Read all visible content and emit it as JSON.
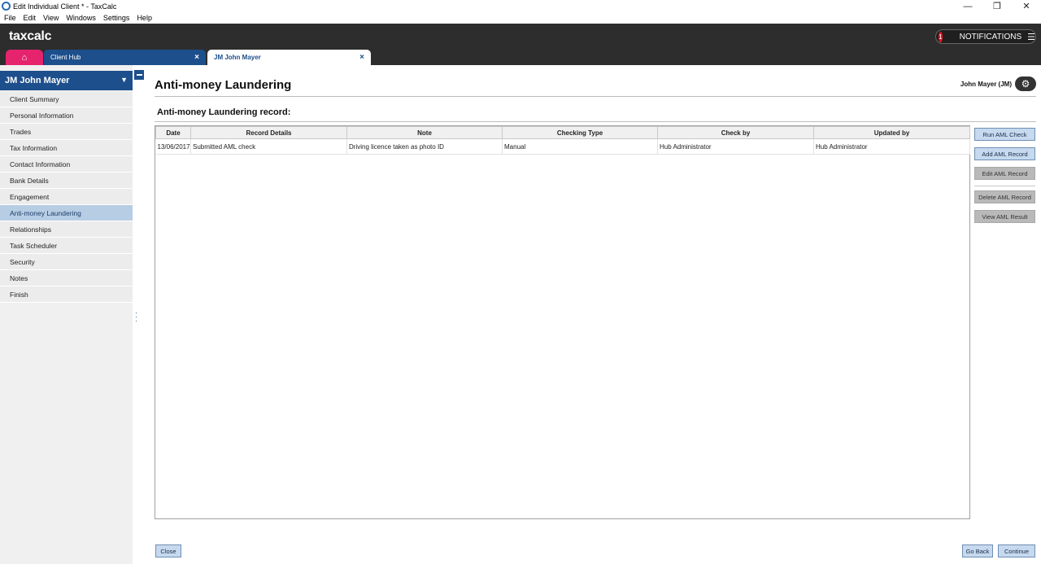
{
  "window": {
    "title": "Edit Individual Client * - TaxCalc",
    "controls": {
      "minimize": "—",
      "restore": "❐",
      "close": "✕"
    }
  },
  "menu": [
    "File",
    "Edit",
    "View",
    "Windows",
    "Settings",
    "Help"
  ],
  "header": {
    "logo": "taxcalc",
    "notifications": {
      "count": "1",
      "label": "NOTIFICATIONS"
    }
  },
  "tabs": [
    {
      "label": "Client Hub"
    },
    {
      "label": "JM John Mayer"
    }
  ],
  "sidebar": {
    "client_name": "JM John  Mayer",
    "items": [
      {
        "label": "Client Summary",
        "active": false
      },
      {
        "label": "Personal Information",
        "active": false
      },
      {
        "label": "Trades",
        "active": false
      },
      {
        "label": "Tax Information",
        "active": false
      },
      {
        "label": "Contact Information",
        "active": false
      },
      {
        "label": "Bank Details",
        "active": false
      },
      {
        "label": "Engagement",
        "active": false
      },
      {
        "label": "Anti-money Laundering",
        "active": true
      },
      {
        "label": "Relationships",
        "active": false
      },
      {
        "label": "Task Scheduler",
        "active": false
      },
      {
        "label": "Security",
        "active": false
      },
      {
        "label": "Notes",
        "active": false
      },
      {
        "label": "Finish",
        "active": false
      }
    ]
  },
  "main": {
    "title": "Anti-money Laundering",
    "user": "John Mayer (JM)",
    "section_title": "Anti-money Laundering record:",
    "table": {
      "columns": [
        "Date",
        "Record Details",
        "Note",
        "Checking Type",
        "Check by",
        "Updated by"
      ],
      "rows": [
        [
          "13/06/2017",
          "Submitted AML check",
          "Driving licence taken as photo ID",
          "Manual",
          "Hub Administrator",
          "Hub Administrator"
        ]
      ]
    },
    "actions": {
      "run": "Run AML Check",
      "add": "Add AML Record",
      "edit": "Edit AML Record",
      "delete": "Delete AML Record",
      "view": "View AML Result"
    }
  },
  "footer": {
    "close": "Close",
    "go_back": "Go Back",
    "continue": "Continue"
  },
  "colors": {
    "header_bg": "#2d2d2d",
    "brand_blue": "#1d4f8c",
    "home_tab": "#e6246e",
    "active_nav": "#b7cde4",
    "notification_badge": "#e0141e"
  }
}
